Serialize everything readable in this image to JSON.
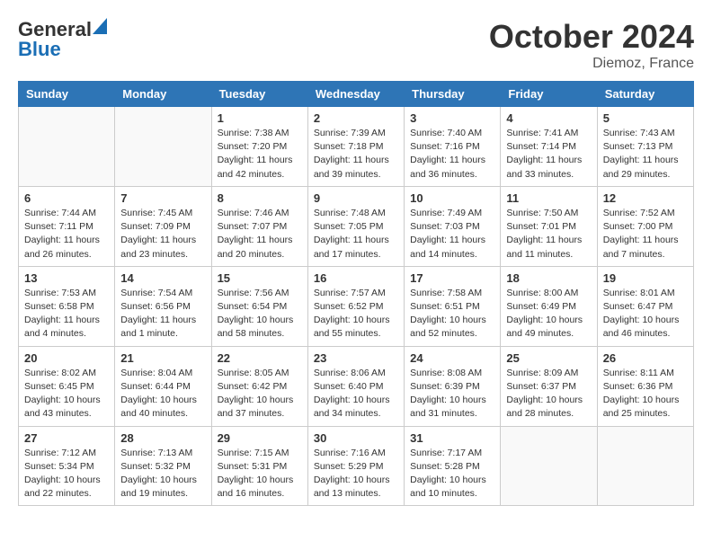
{
  "header": {
    "logo_general": "General",
    "logo_blue": "Blue",
    "month": "October 2024",
    "location": "Diemoz, France"
  },
  "weekdays": [
    "Sunday",
    "Monday",
    "Tuesday",
    "Wednesday",
    "Thursday",
    "Friday",
    "Saturday"
  ],
  "weeks": [
    [
      {
        "day": "",
        "sunrise": "",
        "sunset": "",
        "daylight": ""
      },
      {
        "day": "",
        "sunrise": "",
        "sunset": "",
        "daylight": ""
      },
      {
        "day": "1",
        "sunrise": "Sunrise: 7:38 AM",
        "sunset": "Sunset: 7:20 PM",
        "daylight": "Daylight: 11 hours and 42 minutes."
      },
      {
        "day": "2",
        "sunrise": "Sunrise: 7:39 AM",
        "sunset": "Sunset: 7:18 PM",
        "daylight": "Daylight: 11 hours and 39 minutes."
      },
      {
        "day": "3",
        "sunrise": "Sunrise: 7:40 AM",
        "sunset": "Sunset: 7:16 PM",
        "daylight": "Daylight: 11 hours and 36 minutes."
      },
      {
        "day": "4",
        "sunrise": "Sunrise: 7:41 AM",
        "sunset": "Sunset: 7:14 PM",
        "daylight": "Daylight: 11 hours and 33 minutes."
      },
      {
        "day": "5",
        "sunrise": "Sunrise: 7:43 AM",
        "sunset": "Sunset: 7:13 PM",
        "daylight": "Daylight: 11 hours and 29 minutes."
      }
    ],
    [
      {
        "day": "6",
        "sunrise": "Sunrise: 7:44 AM",
        "sunset": "Sunset: 7:11 PM",
        "daylight": "Daylight: 11 hours and 26 minutes."
      },
      {
        "day": "7",
        "sunrise": "Sunrise: 7:45 AM",
        "sunset": "Sunset: 7:09 PM",
        "daylight": "Daylight: 11 hours and 23 minutes."
      },
      {
        "day": "8",
        "sunrise": "Sunrise: 7:46 AM",
        "sunset": "Sunset: 7:07 PM",
        "daylight": "Daylight: 11 hours and 20 minutes."
      },
      {
        "day": "9",
        "sunrise": "Sunrise: 7:48 AM",
        "sunset": "Sunset: 7:05 PM",
        "daylight": "Daylight: 11 hours and 17 minutes."
      },
      {
        "day": "10",
        "sunrise": "Sunrise: 7:49 AM",
        "sunset": "Sunset: 7:03 PM",
        "daylight": "Daylight: 11 hours and 14 minutes."
      },
      {
        "day": "11",
        "sunrise": "Sunrise: 7:50 AM",
        "sunset": "Sunset: 7:01 PM",
        "daylight": "Daylight: 11 hours and 11 minutes."
      },
      {
        "day": "12",
        "sunrise": "Sunrise: 7:52 AM",
        "sunset": "Sunset: 7:00 PM",
        "daylight": "Daylight: 11 hours and 7 minutes."
      }
    ],
    [
      {
        "day": "13",
        "sunrise": "Sunrise: 7:53 AM",
        "sunset": "Sunset: 6:58 PM",
        "daylight": "Daylight: 11 hours and 4 minutes."
      },
      {
        "day": "14",
        "sunrise": "Sunrise: 7:54 AM",
        "sunset": "Sunset: 6:56 PM",
        "daylight": "Daylight: 11 hours and 1 minute."
      },
      {
        "day": "15",
        "sunrise": "Sunrise: 7:56 AM",
        "sunset": "Sunset: 6:54 PM",
        "daylight": "Daylight: 10 hours and 58 minutes."
      },
      {
        "day": "16",
        "sunrise": "Sunrise: 7:57 AM",
        "sunset": "Sunset: 6:52 PM",
        "daylight": "Daylight: 10 hours and 55 minutes."
      },
      {
        "day": "17",
        "sunrise": "Sunrise: 7:58 AM",
        "sunset": "Sunset: 6:51 PM",
        "daylight": "Daylight: 10 hours and 52 minutes."
      },
      {
        "day": "18",
        "sunrise": "Sunrise: 8:00 AM",
        "sunset": "Sunset: 6:49 PM",
        "daylight": "Daylight: 10 hours and 49 minutes."
      },
      {
        "day": "19",
        "sunrise": "Sunrise: 8:01 AM",
        "sunset": "Sunset: 6:47 PM",
        "daylight": "Daylight: 10 hours and 46 minutes."
      }
    ],
    [
      {
        "day": "20",
        "sunrise": "Sunrise: 8:02 AM",
        "sunset": "Sunset: 6:45 PM",
        "daylight": "Daylight: 10 hours and 43 minutes."
      },
      {
        "day": "21",
        "sunrise": "Sunrise: 8:04 AM",
        "sunset": "Sunset: 6:44 PM",
        "daylight": "Daylight: 10 hours and 40 minutes."
      },
      {
        "day": "22",
        "sunrise": "Sunrise: 8:05 AM",
        "sunset": "Sunset: 6:42 PM",
        "daylight": "Daylight: 10 hours and 37 minutes."
      },
      {
        "day": "23",
        "sunrise": "Sunrise: 8:06 AM",
        "sunset": "Sunset: 6:40 PM",
        "daylight": "Daylight: 10 hours and 34 minutes."
      },
      {
        "day": "24",
        "sunrise": "Sunrise: 8:08 AM",
        "sunset": "Sunset: 6:39 PM",
        "daylight": "Daylight: 10 hours and 31 minutes."
      },
      {
        "day": "25",
        "sunrise": "Sunrise: 8:09 AM",
        "sunset": "Sunset: 6:37 PM",
        "daylight": "Daylight: 10 hours and 28 minutes."
      },
      {
        "day": "26",
        "sunrise": "Sunrise: 8:11 AM",
        "sunset": "Sunset: 6:36 PM",
        "daylight": "Daylight: 10 hours and 25 minutes."
      }
    ],
    [
      {
        "day": "27",
        "sunrise": "Sunrise: 7:12 AM",
        "sunset": "Sunset: 5:34 PM",
        "daylight": "Daylight: 10 hours and 22 minutes."
      },
      {
        "day": "28",
        "sunrise": "Sunrise: 7:13 AM",
        "sunset": "Sunset: 5:32 PM",
        "daylight": "Daylight: 10 hours and 19 minutes."
      },
      {
        "day": "29",
        "sunrise": "Sunrise: 7:15 AM",
        "sunset": "Sunset: 5:31 PM",
        "daylight": "Daylight: 10 hours and 16 minutes."
      },
      {
        "day": "30",
        "sunrise": "Sunrise: 7:16 AM",
        "sunset": "Sunset: 5:29 PM",
        "daylight": "Daylight: 10 hours and 13 minutes."
      },
      {
        "day": "31",
        "sunrise": "Sunrise: 7:17 AM",
        "sunset": "Sunset: 5:28 PM",
        "daylight": "Daylight: 10 hours and 10 minutes."
      },
      {
        "day": "",
        "sunrise": "",
        "sunset": "",
        "daylight": ""
      },
      {
        "day": "",
        "sunrise": "",
        "sunset": "",
        "daylight": ""
      }
    ]
  ]
}
